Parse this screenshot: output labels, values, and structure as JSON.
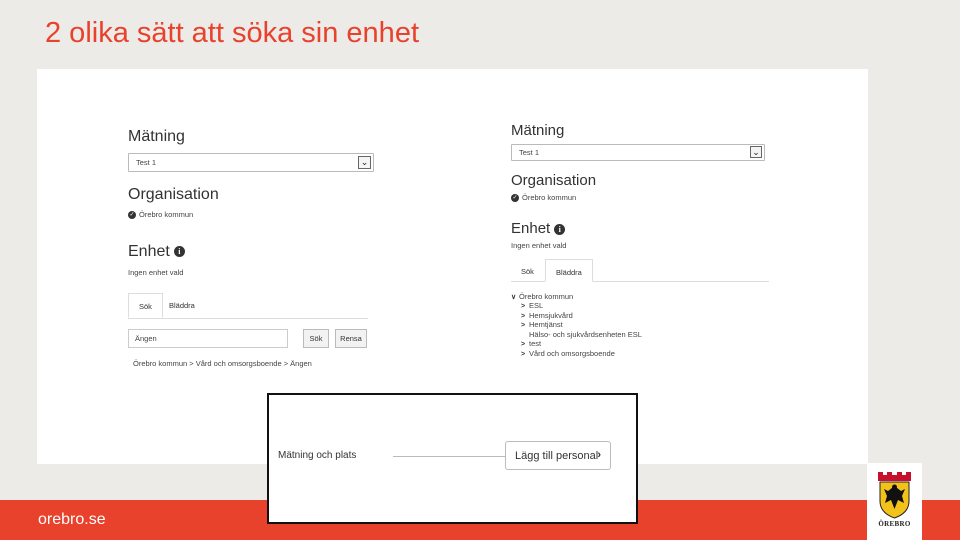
{
  "slide": {
    "title": "2 olika sätt att söka sin enhet",
    "footer_link": "orebro.se",
    "logo_text": "ÖREBRO"
  },
  "colors": {
    "accent": "#e8412c",
    "background": "#edebe8"
  },
  "left_panel": {
    "matning_heading": "Mätning",
    "matning_value": "Test 1",
    "organisation_heading": "Organisation",
    "organisation_value": "Örebro kommun",
    "enhet_heading": "Enhet",
    "enhet_status": "Ingen enhet vald",
    "tabs": [
      "Sök",
      "Bläddra"
    ],
    "search_value": "Ängen",
    "search_button": "Sök",
    "reset_button": "Rensa",
    "result_path": "Örebro kommun > Vård och omsorgsboende > Ängen"
  },
  "right_panel": {
    "matning_heading": "Mätning",
    "matning_value": "Test 1",
    "organisation_heading": "Organisation",
    "organisation_value": "Örebro kommun",
    "enhet_heading": "Enhet",
    "enhet_status": "Ingen enhet vald",
    "tabs": [
      "Sök",
      "Bläddra"
    ],
    "tree_root": "Örebro kommun",
    "tree_children": [
      "ESL",
      "Hemsjukvård",
      "Hemtjänst",
      "Hälso- och sjukvårdsenheten ESL",
      "test",
      "Vård och omsorgsboende"
    ]
  },
  "inset": {
    "label": "Mätning och plats",
    "button_label": "Lägg till personal"
  },
  "icons": {
    "check": "check-circle-icon",
    "info": "info-circle-icon",
    "chevron_right": "chevron-right-icon",
    "chevron_down": "chevron-down-icon"
  }
}
